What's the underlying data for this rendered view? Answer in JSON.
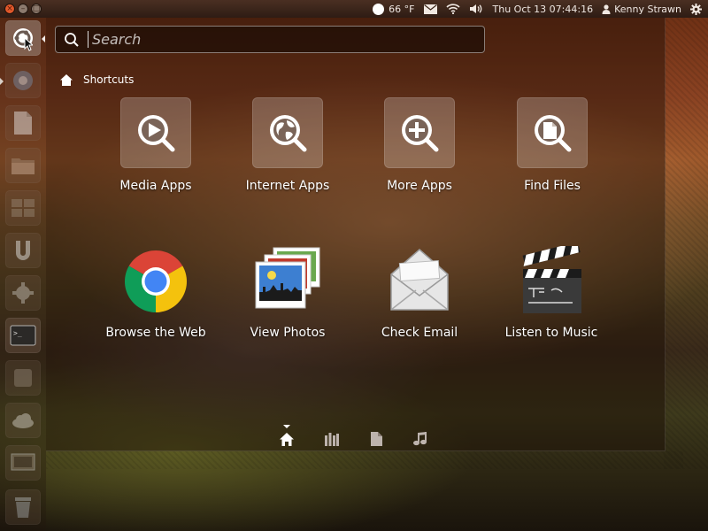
{
  "panel": {
    "window_buttons": [
      "close-icon",
      "minimize-icon",
      "maximize-icon"
    ],
    "weather": "66 °F",
    "clock": "Thu Oct 13 07:44:16",
    "user": "Kenny Strawn"
  },
  "search": {
    "placeholder": "Search",
    "value": ""
  },
  "section": {
    "title": "Shortcuts"
  },
  "shortcuts": [
    {
      "label": "Media Apps",
      "icon": "play-search-icon"
    },
    {
      "label": "Internet Apps",
      "icon": "globe-search-icon"
    },
    {
      "label": "More Apps",
      "icon": "plus-search-icon"
    },
    {
      "label": "Find Files",
      "icon": "file-search-icon"
    }
  ],
  "apps": [
    {
      "label": "Browse the Web",
      "icon": "chrome-icon"
    },
    {
      "label": "View Photos",
      "icon": "photos-icon"
    },
    {
      "label": "Check Email",
      "icon": "email-icon"
    },
    {
      "label": "Listen to Music",
      "icon": "clapperboard-icon"
    }
  ],
  "launcher": [
    "dash-home-icon",
    "chromium-icon",
    "libreoffice-icon",
    "files-icon",
    "workspace-icon",
    "ubuntu-one-icon",
    "settings-icon",
    "terminal-icon",
    "apps-icon",
    "cloud-icon",
    "display-icon",
    "trash-icon"
  ],
  "lenses": [
    "home-lens-icon",
    "applications-lens-icon",
    "files-lens-icon",
    "music-lens-icon"
  ],
  "colors": {
    "accent": "#e3592b",
    "chrome_red": "#db4437",
    "chrome_yellow": "#f4c20d",
    "chrome_green": "#0f9d58",
    "chrome_blue": "#4285f4"
  }
}
